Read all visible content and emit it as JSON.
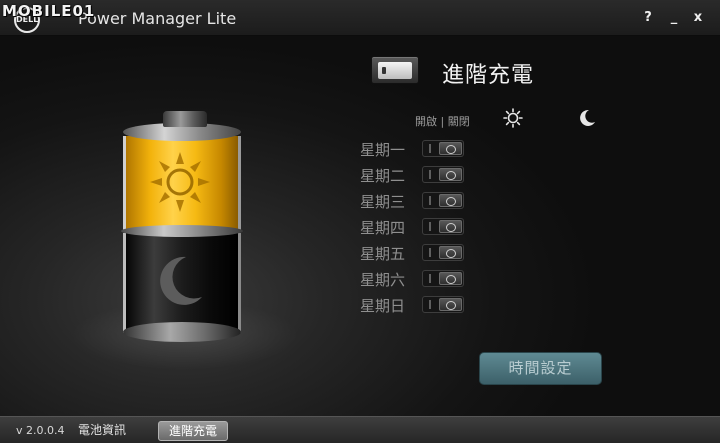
{
  "watermark": "MOBILE01",
  "titlebar": {
    "logo_text": "DELL",
    "app_title": "Power Manager Lite",
    "help_label": "?",
    "minimize_label": "_",
    "close_label": "x"
  },
  "panel": {
    "heading": "進階充電",
    "onoff_header": "開啟 | 關閉",
    "day_icon": "sun-icon",
    "night_icon": "moon-icon",
    "days": [
      {
        "label": "星期一"
      },
      {
        "label": "星期二"
      },
      {
        "label": "星期三"
      },
      {
        "label": "星期四"
      },
      {
        "label": "星期五"
      },
      {
        "label": "星期六"
      },
      {
        "label": "星期日"
      }
    ],
    "time_button_label": "時間設定"
  },
  "battery": {
    "top_color": "#f6ba13",
    "top_icon": "sun-icon",
    "bottom_icon": "moon-icon"
  },
  "bottombar": {
    "version": "v 2.0.0.4",
    "tabs": [
      {
        "label": "電池資訊",
        "active": false
      },
      {
        "label": "進階充電",
        "active": true
      }
    ]
  },
  "colors": {
    "accent_yellow": "#f6ba13",
    "button_teal": "#4f7880"
  }
}
